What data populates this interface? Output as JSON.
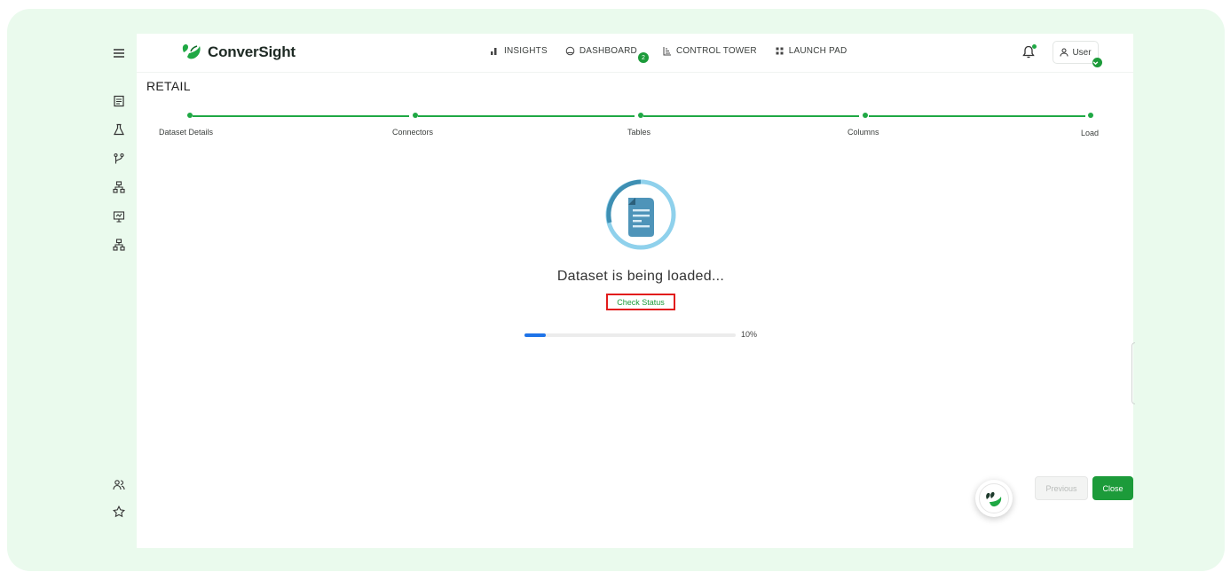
{
  "brand": {
    "name": "ConverSight",
    "accent": "#1c9b3a"
  },
  "nav": {
    "items": [
      {
        "label": "INSIGHTS",
        "icon": "bar-chart-icon"
      },
      {
        "label": "DASHBOARD",
        "icon": "dashboard-gauge-icon",
        "badge": "2"
      },
      {
        "label": "CONTROL TOWER",
        "icon": "control-tower-icon"
      },
      {
        "label": "LAUNCH PAD",
        "icon": "grid-dots-icon"
      }
    ]
  },
  "header": {
    "user_label": "User"
  },
  "sidebar": {
    "icons": [
      "menu-icon",
      "report-icon",
      "flask-icon",
      "branch-icon",
      "hierarchy-icon",
      "presentation-icon",
      "hierarchy-icon",
      "users-icon",
      "star-icon"
    ]
  },
  "page": {
    "title": "RETAIL"
  },
  "stepper": {
    "steps": [
      "Dataset Details",
      "Connectors",
      "Tables",
      "Columns",
      "Load"
    ]
  },
  "status": {
    "message": "Dataset is being loaded...",
    "check_status_label": "Check Status",
    "progress_percent": 10,
    "progress_label": "10%"
  },
  "footer": {
    "previous_label": "Previous",
    "close_label": "Close"
  }
}
